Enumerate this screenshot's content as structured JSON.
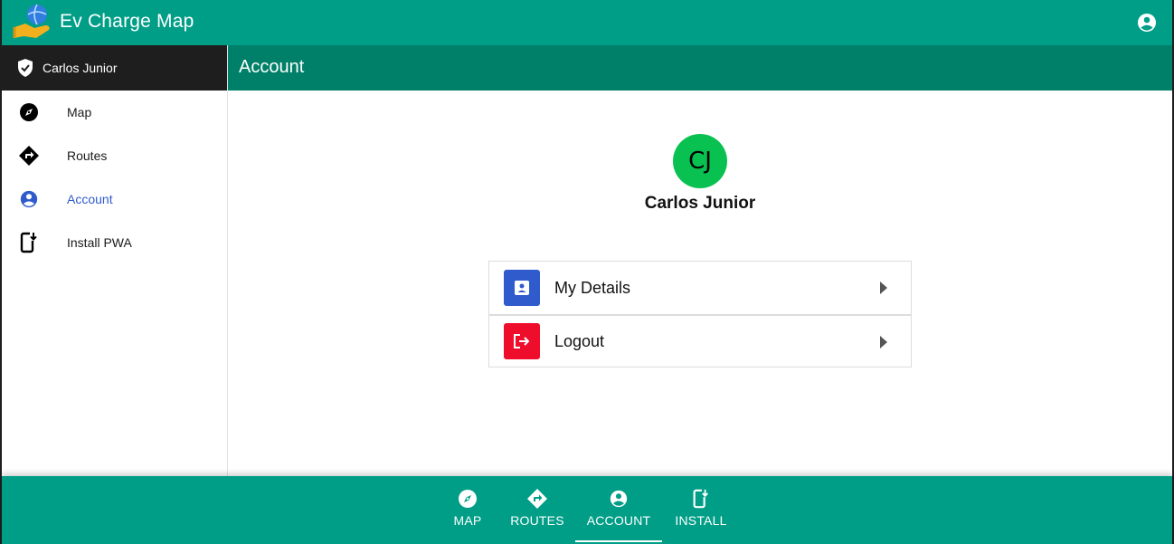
{
  "app": {
    "title": "Ev Charge Map"
  },
  "sidebar": {
    "user_name": "Carlos Junior",
    "items": [
      {
        "label": "Map",
        "icon": "compass-icon"
      },
      {
        "label": "Routes",
        "icon": "directions-icon"
      },
      {
        "label": "Account",
        "icon": "account-circle-icon",
        "active": true
      },
      {
        "label": "Install PWA",
        "icon": "install-mobile-icon"
      }
    ]
  },
  "page": {
    "title": "Account"
  },
  "profile": {
    "initials": "CJ",
    "name": "Carlos Junior"
  },
  "menu": {
    "items": [
      {
        "label": "My Details",
        "icon": "contact-card-icon",
        "color": "#2f5bcc"
      },
      {
        "label": "Logout",
        "icon": "logout-icon",
        "color": "#ef0d2c"
      }
    ]
  },
  "bottom_nav": {
    "items": [
      {
        "label": "MAP",
        "icon": "compass-icon"
      },
      {
        "label": "ROUTES",
        "icon": "directions-icon"
      },
      {
        "label": "ACCOUNT",
        "icon": "account-circle-icon",
        "active": true
      },
      {
        "label": "INSTALL",
        "icon": "install-mobile-icon"
      }
    ]
  },
  "colors": {
    "primary": "#009e87",
    "primary_dark": "#008068",
    "sidebar_header": "#1e1e1e",
    "active_link": "#2f5bcc",
    "avatar": "#09c150"
  }
}
